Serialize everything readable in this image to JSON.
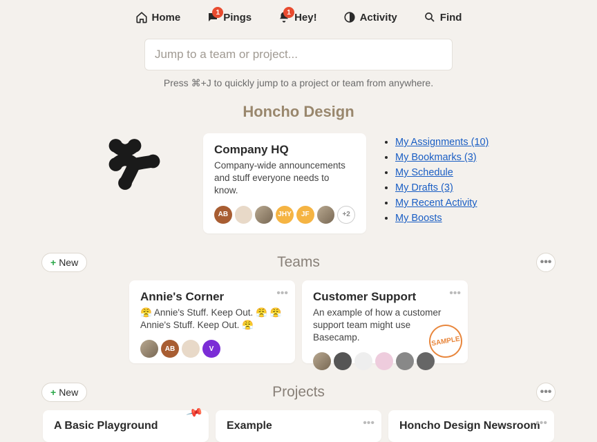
{
  "nav": {
    "home": "Home",
    "pings": "Pings",
    "pings_badge": "1",
    "hey": "Hey!",
    "hey_badge": "1",
    "activity": "Activity",
    "find": "Find"
  },
  "search": {
    "placeholder": "Jump to a team or project...",
    "hint": "Press ⌘+J to quickly jump to a project or team from anywhere."
  },
  "org": {
    "title": "Honcho Design",
    "card": {
      "title": "Company HQ",
      "desc": "Company-wide announcements and stuff everyone needs to know.",
      "avatars": [
        "AB",
        "",
        "",
        "JHY",
        "JF",
        ""
      ],
      "more": "+2"
    },
    "links": [
      "My Assignments (10)",
      "My Bookmarks (3)",
      "My Schedule",
      "My Drafts (3)",
      "My Recent Activity",
      "My Boosts"
    ]
  },
  "teams": {
    "heading": "Teams",
    "new_label": "New",
    "items": [
      {
        "title": "Annie's Corner",
        "desc": "😤 Annie's Stuff. Keep Out. 😤 😤 Annie's Stuff. Keep Out. 😤",
        "avatars": [
          "",
          "AB",
          "",
          "V"
        ]
      },
      {
        "title": "Customer Support",
        "desc": "An example of how a customer support team might use Basecamp.",
        "sample": "SAMPLE",
        "avatars": [
          "",
          "",
          "",
          "",
          "",
          ""
        ]
      }
    ]
  },
  "projects": {
    "heading": "Projects",
    "new_label": "New",
    "items": [
      {
        "title": "A Basic Playground",
        "pinned": true
      },
      {
        "title": "Example"
      },
      {
        "title": "Honcho Design Newsroom"
      }
    ]
  }
}
